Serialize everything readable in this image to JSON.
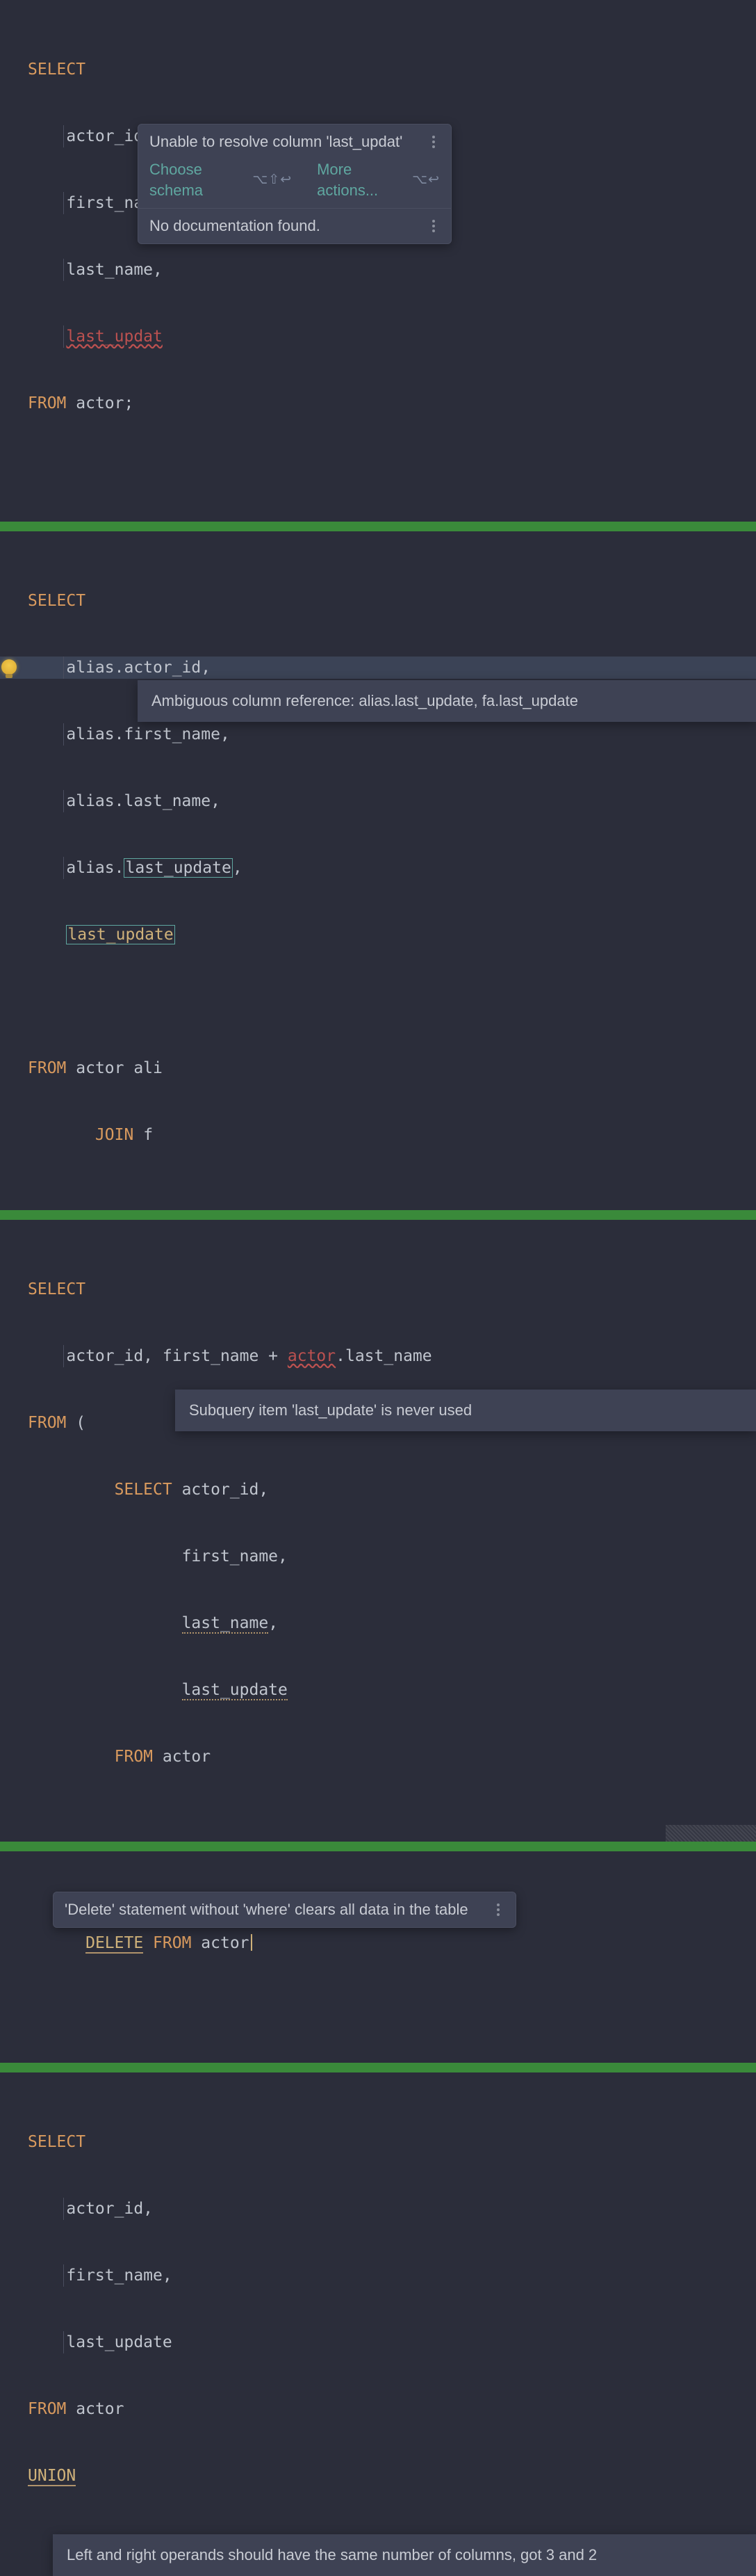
{
  "panel1": {
    "kw_select": "SELECT",
    "col1": "actor_id,",
    "col2": "first_name,",
    "col3": "last_name,",
    "col4_err": "last_updat",
    "kw_from": "FROM",
    "table": "actor",
    "semi": ";",
    "popup": {
      "error": "Unable to resolve column 'last_updat'",
      "choose_schema": "Choose schema",
      "choose_kbd": "⌥⇧↩",
      "more_actions": "More actions...",
      "more_kbd": "⌥↩",
      "no_doc": "No documentation found."
    }
  },
  "panel2": {
    "kw_select": "SELECT",
    "c1": "alias.actor_id,",
    "c2": "alias.first_name,",
    "c3": "alias.last_name,",
    "c4_prefix": "alias.",
    "c4_box": "last_update",
    "c4_suffix": ",",
    "c5_warn": "last_update",
    "kw_from": "FROM",
    "from_rest": "actor ali",
    "kw_join": "JOIN",
    "join_rest": "f",
    "tooltip": "Ambiguous column reference: alias.last_update, fa.last_update"
  },
  "panel3": {
    "kw_select": "SELECT",
    "line1_a": "actor_id, first_name + ",
    "line1_err": "actor",
    "line1_b": ".last_name",
    "kw_from": "FROM",
    "paren": "(",
    "sub_select": "SELECT",
    "sub_c1": "actor_id,",
    "sub_c2": "first_name,",
    "sub_c3": "last_name",
    "sub_c3_comma": ",",
    "sub_c4": "last_update",
    "sub_from": "FROM",
    "sub_table": "actor",
    "tooltip": "Subquery item 'last_update' is never used"
  },
  "panel4": {
    "kw_delete": "DELETE",
    "kw_from": "FROM",
    "table": "actor",
    "tooltip": "'Delete' statement without 'where' clears all data in the table"
  },
  "panel5": {
    "kw_select": "SELECT",
    "c1": "actor_id,",
    "c2": "first_name,",
    "c3": "last_update",
    "kw_from": "FROM",
    "table": "actor",
    "kw_union": "UNION",
    "tooltip": "Left and right operands should have the same number of columns, got 3 and 2"
  }
}
